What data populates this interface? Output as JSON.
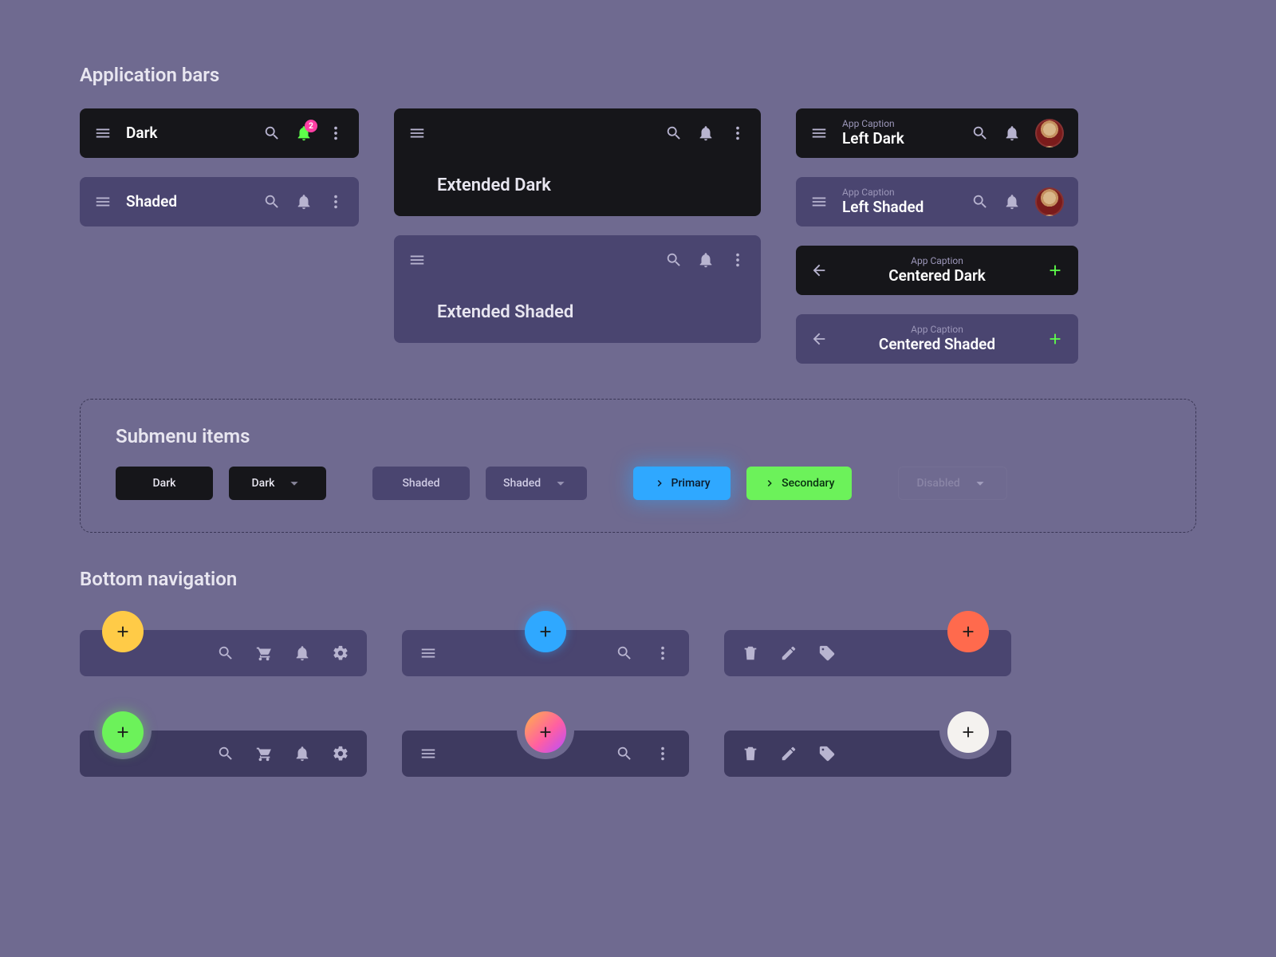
{
  "sections": {
    "appbars": "Application bars",
    "submenu": "Submenu items",
    "bottomnav": "Bottom navigation"
  },
  "appbars": {
    "dark": {
      "title": "Dark",
      "badge": "2"
    },
    "shaded": {
      "title": "Shaded"
    },
    "ext_dark": {
      "title": "Extended Dark"
    },
    "ext_shaded": {
      "title": "Extended Shaded"
    },
    "left_dark": {
      "caption": "App Caption",
      "title": "Left Dark"
    },
    "left_shaded": {
      "caption": "App Caption",
      "title": "Left Shaded"
    },
    "centered_dark": {
      "caption": "App Caption",
      "title": "Centered Dark"
    },
    "centered_shaded": {
      "caption": "App Caption",
      "title": "Centered Shaded"
    }
  },
  "submenu": {
    "dark1": "Dark",
    "dark2": "Dark",
    "shaded1": "Shaded",
    "shaded2": "Shaded",
    "primary": "Primary",
    "secondary": "Secondary",
    "disabled": "Disabled"
  },
  "colors": {
    "accent_blue": "#2fa8ff",
    "accent_green": "#6cf25a",
    "accent_yellow": "#ffcb47",
    "accent_coral": "#ff6a4d",
    "accent_pink": "#ff3fa4"
  }
}
